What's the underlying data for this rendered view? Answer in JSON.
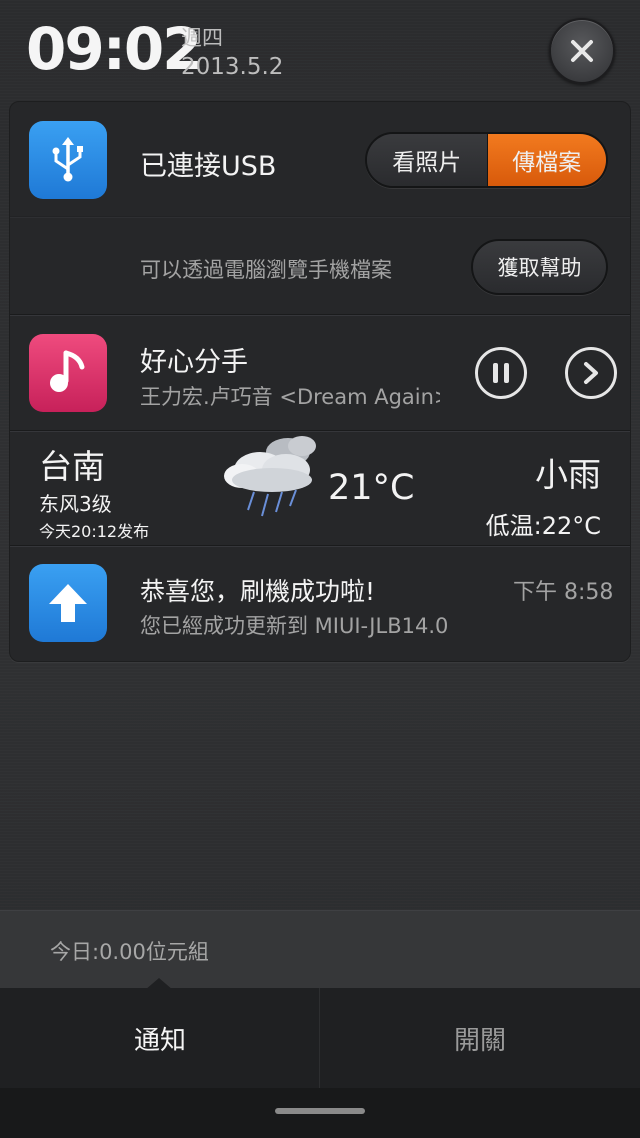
{
  "status": {
    "time": "09:02",
    "weekday": "週四",
    "date": "2013.5.2"
  },
  "usb": {
    "title": "已連接USB",
    "btn_photos": "看照片",
    "btn_files": "傳檔案",
    "description": "可以透過電腦瀏覽手機檔案",
    "help_label": "獲取幫助"
  },
  "music": {
    "title": "好心分手",
    "artist": "王力宏.卢巧音  <Dream Again>"
  },
  "weather": {
    "city": "台南",
    "wind": "东风3级",
    "published": "今天20:12发布",
    "temperature": "21°C",
    "condition": "小雨",
    "low_temp": "低温:22°C"
  },
  "update": {
    "title": "恭喜您，刷機成功啦!",
    "time": "下午 8:58",
    "message": "您已經成功更新到 MIUI-JLB14.0"
  },
  "data_usage": "今日:0.00位元組",
  "tabs": {
    "notifications": "通知",
    "toggles": "開關"
  },
  "colors": {
    "accent_orange": "#e8690f",
    "icon_blue": "#2a8ae6",
    "icon_pink": "#dc3468"
  },
  "icons": {
    "usb": "usb-icon",
    "music": "music-note-icon",
    "pause": "pause-icon",
    "next": "chevron-right-icon",
    "weather": "cloud-rain-icon",
    "update": "arrow-up-icon",
    "close": "close-icon"
  }
}
